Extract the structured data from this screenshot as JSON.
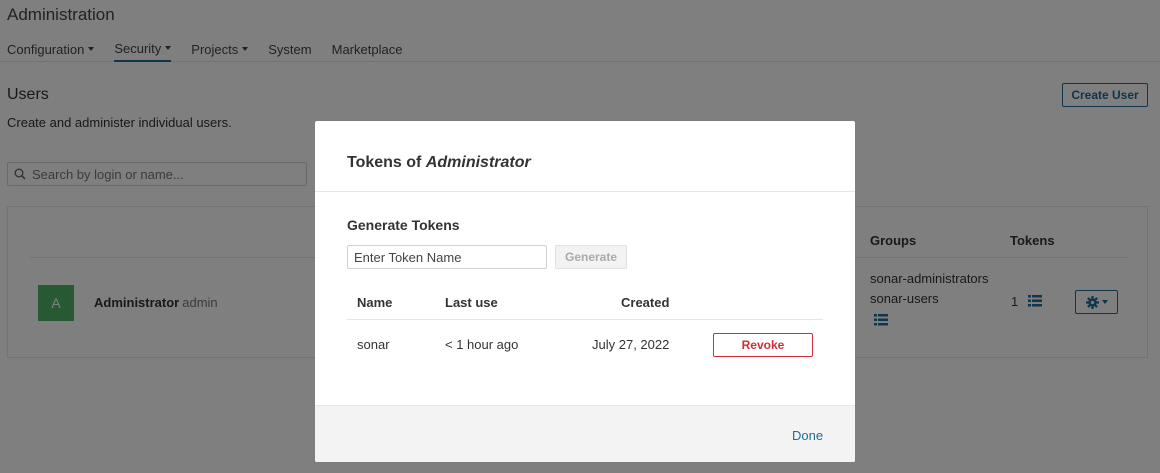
{
  "header": {
    "title": "Administration",
    "nav": [
      {
        "label": "Configuration"
      },
      {
        "label": "Security"
      },
      {
        "label": "Projects"
      },
      {
        "label": "System"
      },
      {
        "label": "Marketplace"
      }
    ]
  },
  "users_page": {
    "title": "Users",
    "description": "Create and administer individual users.",
    "create_user_label": "Create User",
    "search_placeholder": "Search by login or name...",
    "columns": {
      "groups": "Groups",
      "tokens": "Tokens"
    },
    "user": {
      "avatar_letter": "A",
      "name": "Administrator",
      "login": "admin",
      "groups": [
        "sonar-administrators",
        "sonar-users"
      ],
      "token_count": "1"
    }
  },
  "modal": {
    "title_prefix": "Tokens of ",
    "title_user": "Administrator",
    "generate_section_title": "Generate Tokens",
    "token_name_placeholder": "Enter Token Name",
    "generate_label": "Generate",
    "table": {
      "headers": {
        "name": "Name",
        "last_use": "Last use",
        "created": "Created"
      },
      "rows": [
        {
          "name": "sonar",
          "last_use": "< 1 hour ago",
          "created": "July 27, 2022",
          "action": "Revoke"
        }
      ]
    },
    "done_label": "Done"
  },
  "colors": {
    "accent": "#236a97",
    "danger": "#d02f3a",
    "avatar": "#4eb265",
    "overlay": "rgba(0,0,0,0.5)"
  }
}
